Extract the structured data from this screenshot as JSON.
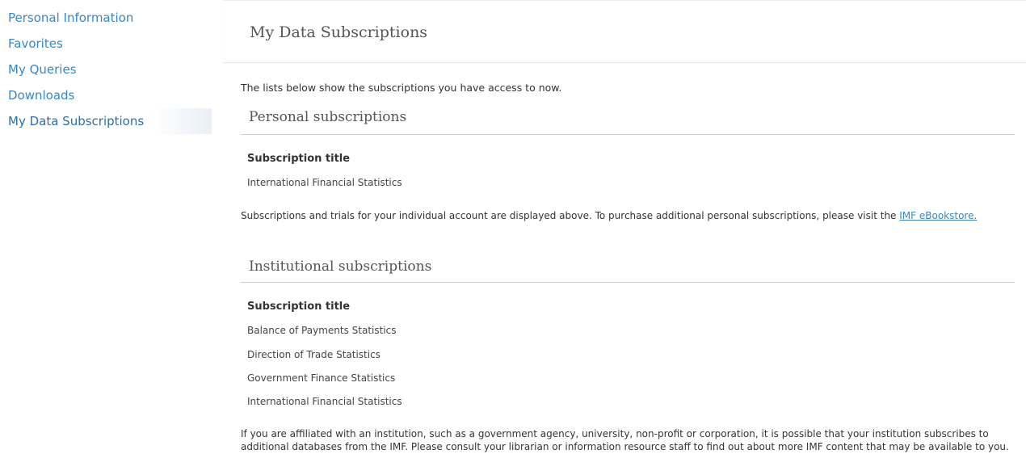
{
  "sidebar": {
    "items": [
      {
        "label": "Personal Information"
      },
      {
        "label": "Favorites"
      },
      {
        "label": "My Queries"
      },
      {
        "label": "Downloads"
      },
      {
        "label": "My Data Subscriptions",
        "active": true
      }
    ]
  },
  "main": {
    "title": "My Data Subscriptions",
    "intro": "The lists below show the subscriptions you have access to now.",
    "personal": {
      "heading": "Personal subscriptions",
      "column_header": "Subscription title",
      "items": [
        "International Financial Statistics"
      ],
      "note_prefix": "Subscriptions and trials for your individual account are displayed above. To purchase additional personal subscriptions, please visit the",
      "note_link": "IMF eBookstore."
    },
    "institutional": {
      "heading": "Institutional subscriptions",
      "column_header": "Subscription title",
      "items": [
        "Balance of Payments Statistics",
        "Direction of Trade Statistics",
        "Government Finance Statistics",
        "International Financial Statistics"
      ],
      "note": "If you are affiliated with an institution, such as a government agency, university, non-profit or corporation, it is possible that your institution subscribes to additional databases from the IMF. Please consult your librarian or information resource staff to find out about more IMF content that may be available to you."
    }
  },
  "colors": {
    "link": "#3a86c4",
    "text": "#333333",
    "heading": "#555555",
    "rule": "#cfcfcf"
  }
}
